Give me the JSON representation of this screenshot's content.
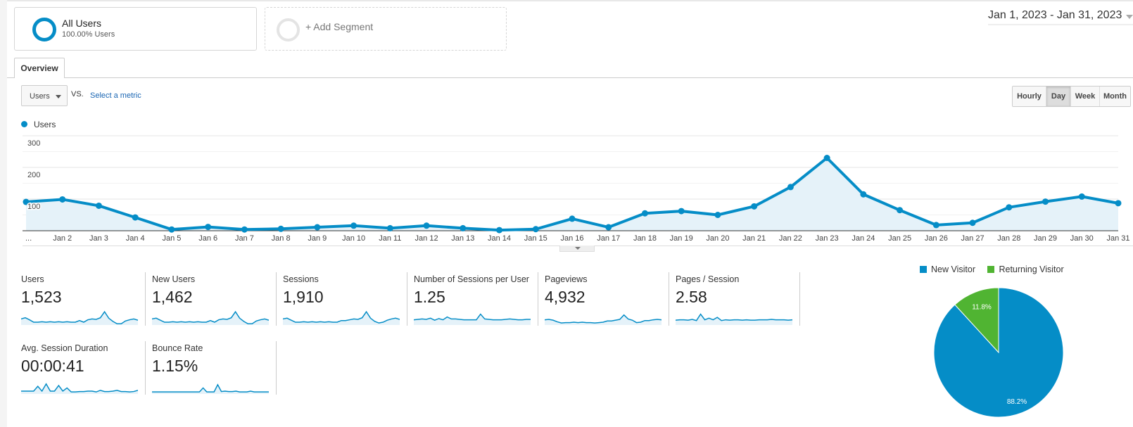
{
  "segments": {
    "all_users": {
      "title": "All Users",
      "subtitle": "100.00% Users"
    },
    "add_segment": {
      "label": "+ Add Segment"
    }
  },
  "date_range": "Jan 1, 2023 - Jan 31, 2023",
  "tabs": [
    {
      "label": "Overview",
      "active": true
    }
  ],
  "metric_selector": {
    "selected": "Users",
    "vs_label": "VS.",
    "compare_link": "Select a metric"
  },
  "granularity": [
    {
      "label": "Hourly",
      "active": false
    },
    {
      "label": "Day",
      "active": true
    },
    {
      "label": "Week",
      "active": false
    },
    {
      "label": "Month",
      "active": false
    }
  ],
  "colors": {
    "primary": "#058dc7",
    "area_fill": "#e5f2f9",
    "returning": "#50b432"
  },
  "chart_data": [
    {
      "type": "line",
      "title": "",
      "legend": [
        "Users"
      ],
      "legend_position": "top-left",
      "xlabel": "",
      "ylabel": "",
      "ylim": [
        0,
        300
      ],
      "y_ticks": [
        "100",
        "200",
        "300"
      ],
      "grid": true,
      "x_tick_labels": [
        "...",
        "Jan 2",
        "Jan 3",
        "Jan 4",
        "Jan 5",
        "Jan 6",
        "Jan 7",
        "Jan 8",
        "Jan 9",
        "Jan 10",
        "Jan 11",
        "Jan 12",
        "Jan 13",
        "Jan 14",
        "Jan 15",
        "Jan 16",
        "Jan 17",
        "Jan 18",
        "Jan 19",
        "Jan 20",
        "Jan 21",
        "Jan 22",
        "Jan 23",
        "Jan 24",
        "Jan 25",
        "Jan 26",
        "Jan 27",
        "Jan 28",
        "Jan 29",
        "Jan 30",
        "Jan 31"
      ],
      "series": [
        {
          "name": "Users",
          "values": [
            91,
            99,
            79,
            42,
            4,
            12,
            4,
            6,
            11,
            16,
            8,
            16,
            8,
            2,
            5,
            38,
            11,
            55,
            62,
            50,
            77,
            138,
            230,
            115,
            65,
            18,
            25,
            74,
            92,
            108,
            87
          ]
        }
      ]
    },
    {
      "type": "pie",
      "title": "",
      "legend_position": "top",
      "labels": [
        "New Visitor",
        "Returning Visitor"
      ],
      "values": [
        88.2,
        11.8
      ],
      "value_labels": [
        "88.2%",
        "11.8%"
      ]
    }
  ],
  "metrics": [
    {
      "name": "Users",
      "value": "1,523",
      "spark": [
        30,
        33,
        28,
        22,
        22,
        23,
        22,
        23,
        22,
        23,
        22,
        23,
        22,
        22,
        26,
        22,
        28,
        30,
        29,
        33,
        48,
        32,
        24,
        18,
        18,
        25,
        28,
        30,
        27
      ]
    },
    {
      "name": "New Users",
      "value": "1,462",
      "spark": [
        30,
        32,
        27,
        22,
        22,
        23,
        22,
        23,
        22,
        23,
        22,
        23,
        22,
        22,
        26,
        22,
        28,
        30,
        29,
        33,
        48,
        32,
        24,
        18,
        18,
        25,
        28,
        30,
        27
      ]
    },
    {
      "name": "Sessions",
      "value": "1,910",
      "spark": [
        30,
        32,
        27,
        22,
        22,
        23,
        22,
        23,
        22,
        23,
        22,
        23,
        22,
        22,
        26,
        26,
        28,
        30,
        29,
        33,
        48,
        32,
        24,
        20,
        22,
        27,
        30,
        32,
        29
      ]
    },
    {
      "name": "Number of Sessions per User",
      "value": "1.25",
      "spark": [
        28,
        29,
        30,
        29,
        32,
        27,
        31,
        28,
        35,
        30,
        30,
        29,
        28,
        28,
        28,
        28,
        42,
        30,
        29,
        28,
        28,
        28,
        29,
        30,
        29,
        28,
        28,
        29,
        29
      ]
    },
    {
      "name": "Pageviews",
      "value": "4,932",
      "spark": [
        28,
        29,
        27,
        23,
        20,
        21,
        21,
        22,
        21,
        22,
        21,
        21,
        20,
        21,
        22,
        25,
        25,
        27,
        29,
        40,
        30,
        27,
        21,
        22,
        26,
        26,
        28,
        29,
        28
      ]
    },
    {
      "name": "Pages / Session",
      "value": "2.58",
      "spark": [
        27,
        28,
        28,
        27,
        29,
        26,
        42,
        28,
        32,
        28,
        34,
        26,
        28,
        27,
        28,
        28,
        27,
        28,
        27,
        27,
        28,
        28,
        28,
        29,
        28,
        28,
        28,
        27,
        28
      ]
    },
    {
      "name": "Avg. Session Duration",
      "value": "00:00:41",
      "spark": [
        22,
        22,
        22,
        22,
        34,
        22,
        40,
        22,
        22,
        36,
        22,
        30,
        20,
        20,
        21,
        21,
        22,
        22,
        20,
        24,
        21,
        21,
        22,
        24,
        21,
        21,
        20,
        21,
        24
      ]
    },
    {
      "name": "Bounce Rate",
      "value": "1.15%",
      "spark": [
        20,
        20,
        20,
        20,
        20,
        20,
        20,
        20,
        20,
        20,
        20,
        20,
        20,
        20,
        30,
        20,
        20,
        20,
        38,
        21,
        22,
        21,
        21,
        22,
        20,
        20,
        20,
        22,
        20,
        20,
        20,
        20,
        20
      ]
    }
  ]
}
